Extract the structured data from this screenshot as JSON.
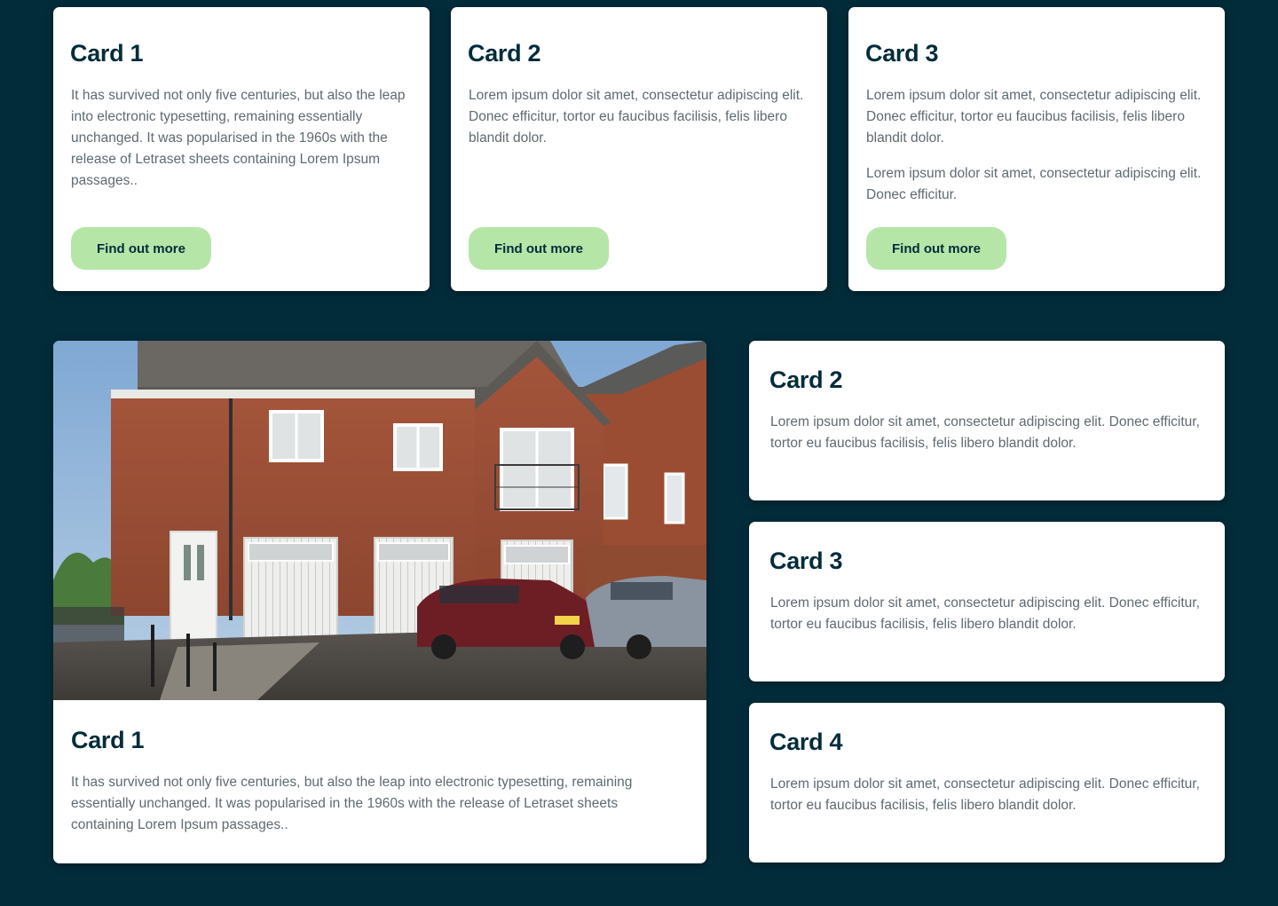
{
  "top_cards": [
    {
      "title": "Card 1",
      "paragraphs": [
        "It has survived not only five centuries, but also the leap into electronic typesetting, remaining essentially unchanged. It was popularised in the 1960s with the release of Letraset sheets containing Lorem Ipsum passages.."
      ],
      "button_label": "Find out more"
    },
    {
      "title": "Card 2",
      "paragraphs": [
        "Lorem ipsum dolor sit amet, consectetur adipiscing elit. Donec efficitur, tortor eu faucibus facilisis, felis libero blandit dolor."
      ],
      "button_label": "Find out more"
    },
    {
      "title": "Card 3",
      "paragraphs": [
        "Lorem ipsum dolor sit amet, consectetur adipiscing elit. Donec efficitur, tortor eu faucibus facilisis, felis libero blandit dolor.",
        "Lorem ipsum dolor sit amet, consectetur adipiscing elit. Donec efficitur."
      ],
      "button_label": "Find out more"
    }
  ],
  "feature_card": {
    "title": "Card 1",
    "text": "It has survived not only five centuries, but also the leap into electronic typesetting, remaining essentially unchanged. It was popularised in the 1960s with the release of Letraset sheets containing Lorem Ipsum passages.."
  },
  "side_cards": [
    {
      "title": "Card 2",
      "text": "Lorem ipsum dolor sit amet, consectetur adipiscing elit. Donec efficitur, tortor eu faucibus facilisis, felis libero blandit dolor."
    },
    {
      "title": "Card 3",
      "text": "Lorem ipsum dolor sit amet, consectetur adipiscing elit. Donec efficitur, tortor eu faucibus facilisis, felis libero blandit dolor."
    },
    {
      "title": "Card 4",
      "text": "Lorem ipsum dolor sit amet, consectetur adipiscing elit. Donec efficitur, tortor eu faucibus facilisis, felis libero blandit dolor."
    }
  ],
  "colors": {
    "background": "#032c3a",
    "heading": "#032c3a",
    "body_text": "#5f6a70",
    "button": "#b5e6a8",
    "card": "#ffffff"
  }
}
